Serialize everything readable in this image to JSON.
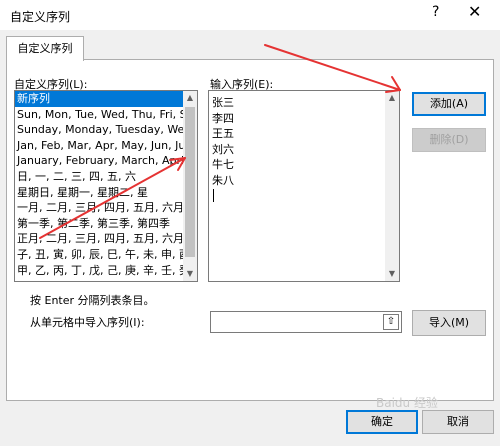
{
  "window": {
    "title": "自定义序列",
    "help": "?",
    "close": "✕"
  },
  "tab_label": "自定义序列",
  "list_label": "自定义序列(L):",
  "entries_label": "输入序列(E):",
  "list_items": [
    "新序列",
    "Sun, Mon, Tue, Wed, Thu, Fri, S",
    "Sunday, Monday, Tuesday, Wed",
    "Jan, Feb, Mar, Apr, May, Jun, Ju",
    "January, February, March, April",
    "日, 一, 二, 三, 四, 五, 六",
    "星期日, 星期一, 星期二, 星",
    "一月, 二月, 三月, 四月, 五月, 六月",
    "第一季, 第二季, 第三季, 第四季",
    "正月, 二月, 三月, 四月, 五月, 六月",
    "子, 丑, 寅, 卯, 辰, 巳, 午, 未, 申, 酉",
    "甲, 乙, 丙, 丁, 戊, 己, 庚, 辛, 壬, 癸"
  ],
  "selected_index": 0,
  "entries": "张三\n李四\n王五\n刘六\n牛七\n朱八",
  "add_button": "添加(A)",
  "delete_button": "删除(D)",
  "hint": "按 Enter 分隔列表条目。",
  "import_label": "从单元格中导入序列(I):",
  "import_value": "",
  "import_button": "导入(M)",
  "ok_button": "确定",
  "cancel_button": "取消",
  "watermark": "Baidu 经验",
  "colors": {
    "selection": "#0078d7",
    "annotation_arrow": "#e53333"
  },
  "icons": [
    "help-icon",
    "close-icon",
    "scroll-up-icon",
    "scroll-down-icon",
    "range-select-icon"
  ]
}
